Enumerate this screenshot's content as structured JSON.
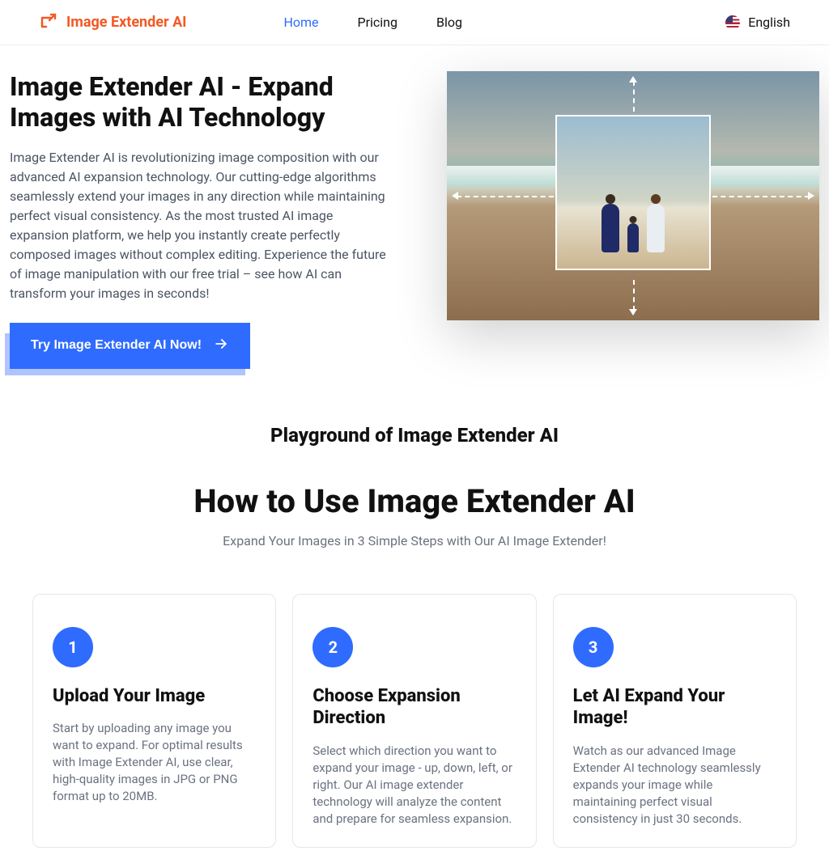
{
  "brand": {
    "name": "Image Extender AI",
    "icon": "extend-arrow-icon",
    "accent": "#f15a24"
  },
  "nav": {
    "items": [
      {
        "label": "Home",
        "active": true
      },
      {
        "label": "Pricing",
        "active": false
      },
      {
        "label": "Blog",
        "active": false
      }
    ]
  },
  "language": {
    "icon": "us-flag-icon",
    "label": "English"
  },
  "hero": {
    "title": "Image Extender AI - Expand Images with AI Technology",
    "body": "Image Extender AI is revolutionizing image composition with our advanced AI expansion technology. Our cutting-edge algorithms seamlessly extend your images in any direction while maintaining perfect visual consistency. As the most trusted AI image expansion platform, we help you instantly create perfectly composed images without complex editing. Experience the future of image manipulation with our free trial – see how AI can transform your images in seconds!",
    "cta_label": "Try Image Extender AI Now!",
    "cta_icon": "arrow-right-icon",
    "image_alt": "Beach scene showing how AI extends image edges in four directions"
  },
  "playground": {
    "title": "Playground of Image Extender AI"
  },
  "howto": {
    "title": "How to Use Image Extender AI",
    "subtitle": "Expand Your Images in 3 Simple Steps with Our AI Image Extender!",
    "steps": [
      {
        "num": "1",
        "title": "Upload Your Image",
        "body": "Start by uploading any image you want to expand. For optimal results with Image Extender AI, use clear, high-quality images in JPG or PNG format up to 20MB."
      },
      {
        "num": "2",
        "title": "Choose Expansion Direction",
        "body": "Select which direction you want to expand your image - up, down, left, or right. Our AI image extender technology will analyze the content and prepare for seamless expansion."
      },
      {
        "num": "3",
        "title": "Let AI Expand Your Image!",
        "body": "Watch as our advanced Image Extender AI technology seamlessly expands your image while maintaining perfect visual consistency in just 30 seconds."
      }
    ]
  },
  "colors": {
    "primary": "#2f6bff",
    "brand_accent": "#f15a24",
    "text_muted": "#6b7280"
  }
}
